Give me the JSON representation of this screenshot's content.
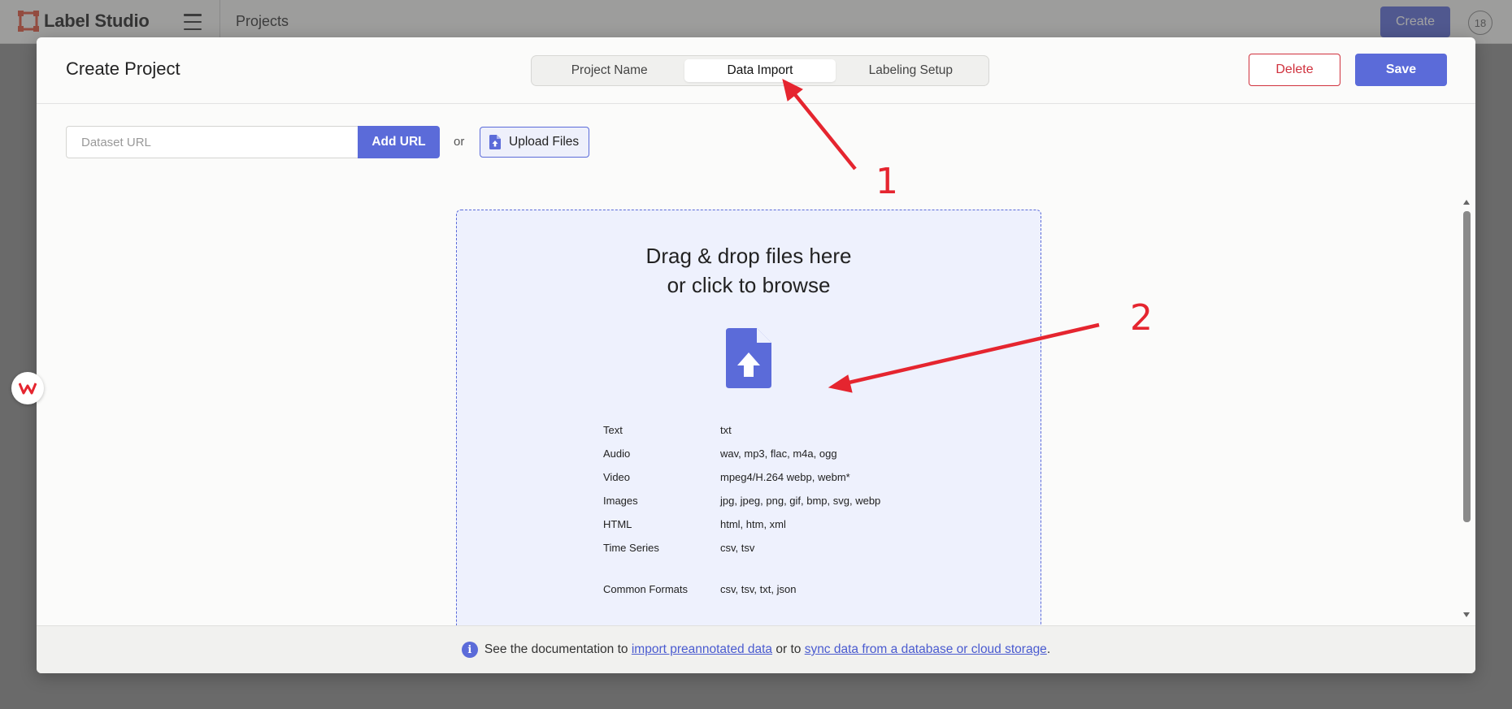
{
  "app": {
    "name": "Label Studio",
    "page_title": "Projects",
    "create_label": "Create",
    "badge_count": "18"
  },
  "modal": {
    "title": "Create Project",
    "tabs": [
      {
        "label": "Project Name",
        "active": false
      },
      {
        "label": "Data Import",
        "active": true
      },
      {
        "label": "Labeling Setup",
        "active": false
      }
    ],
    "delete_label": "Delete",
    "save_label": "Save"
  },
  "import": {
    "url_placeholder": "Dataset URL",
    "add_url_label": "Add URL",
    "or_label": "or",
    "upload_label": "Upload Files"
  },
  "dropzone": {
    "line1": "Drag & drop files here",
    "line2": "or click to browse",
    "icon": "file-upload-icon",
    "formats": [
      {
        "category": "Text",
        "extensions": "txt"
      },
      {
        "category": "Audio",
        "extensions": "wav, mp3, flac, m4a, ogg"
      },
      {
        "category": "Video",
        "extensions": "mpeg4/H.264 webp, webm*"
      },
      {
        "category": "Images",
        "extensions": "jpg, jpeg, png, gif, bmp, svg, webp"
      },
      {
        "category": "HTML",
        "extensions": "html, htm, xml"
      },
      {
        "category": "Time Series",
        "extensions": "csv, tsv"
      }
    ],
    "common": {
      "category": "Common Formats",
      "extensions": "csv, tsv, txt, json"
    }
  },
  "footer": {
    "prefix": "See the documentation to ",
    "link1": "import preannotated data",
    "middle": " or to ",
    "link2": "sync data from a database or cloud storage",
    "suffix": "."
  },
  "annotations": {
    "marker1": "1",
    "marker2": "2"
  },
  "colors": {
    "accent": "#5b6bd9",
    "danger": "#d0313d",
    "annotation": "#e5252f"
  }
}
